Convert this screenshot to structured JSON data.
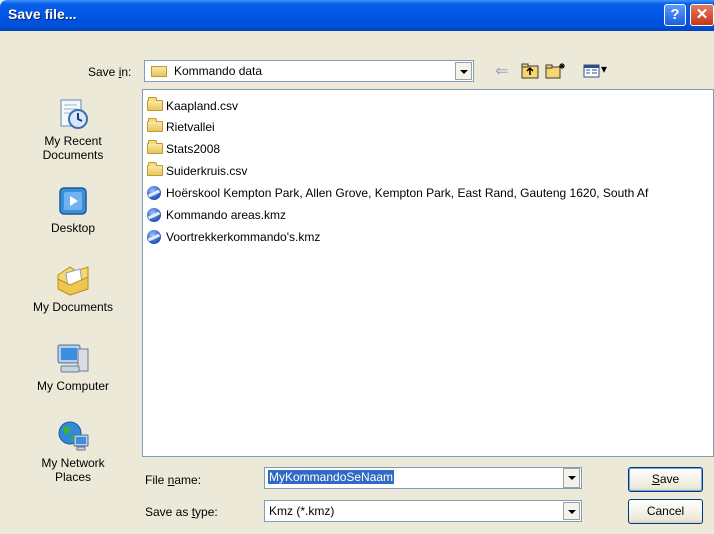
{
  "window": {
    "title": "Save file...",
    "help_glyph": "?",
    "close_glyph": "✕"
  },
  "save_in": {
    "label_pre": "Save ",
    "label_key": "i",
    "label_post": "n:",
    "value": "Kommando data"
  },
  "toolbar": {
    "icons": [
      "back-arrow-icon",
      "up-folder-icon",
      "new-folder-icon",
      "view-menu-icon"
    ],
    "back_glyph": "⇐",
    "view_glyph": "▾"
  },
  "places": [
    {
      "label_line1": "My Recent",
      "label_line2": "Documents",
      "icon": "my-recent-documents-icon"
    },
    {
      "label_line1": "Desktop",
      "label_line2": "",
      "icon": "desktop-icon"
    },
    {
      "label_line1": "My Documents",
      "label_line2": "",
      "icon": "my-documents-icon"
    },
    {
      "label_line1": "My Computer",
      "label_line2": "",
      "icon": "my-computer-icon"
    },
    {
      "label_line1": "My Network",
      "label_line2": "Places",
      "icon": "my-network-places-icon"
    }
  ],
  "files": [
    {
      "name": "Kaapland.csv",
      "type": "folder"
    },
    {
      "name": "Rietvallei",
      "type": "folder"
    },
    {
      "name": "Stats2008",
      "type": "folder"
    },
    {
      "name": "Suiderkruis.csv",
      "type": "folder"
    },
    {
      "name": "Hoërskool Kempton Park, Allen Grove, Kempton Park, East Rand, Gauteng 1620, South Af",
      "type": "kmz"
    },
    {
      "name": "Kommando areas.kmz",
      "type": "kmz"
    },
    {
      "name": "Voortrekkerkommando's.kmz",
      "type": "kmz"
    }
  ],
  "file_name": {
    "label_pre": "File ",
    "label_key": "n",
    "label_post": "ame:",
    "value": "MyKommandoSeNaam"
  },
  "save_as_type": {
    "label_pre": "Save as ",
    "label_key": "t",
    "label_post": "ype:",
    "value": "Kmz (*.kmz)"
  },
  "buttons": {
    "save_key": "S",
    "save_rest": "ave",
    "cancel": "Cancel"
  },
  "colors": {
    "titlebar": "#0055e5",
    "dialog_bg": "#ece9d8",
    "selection": "#316ac5"
  }
}
